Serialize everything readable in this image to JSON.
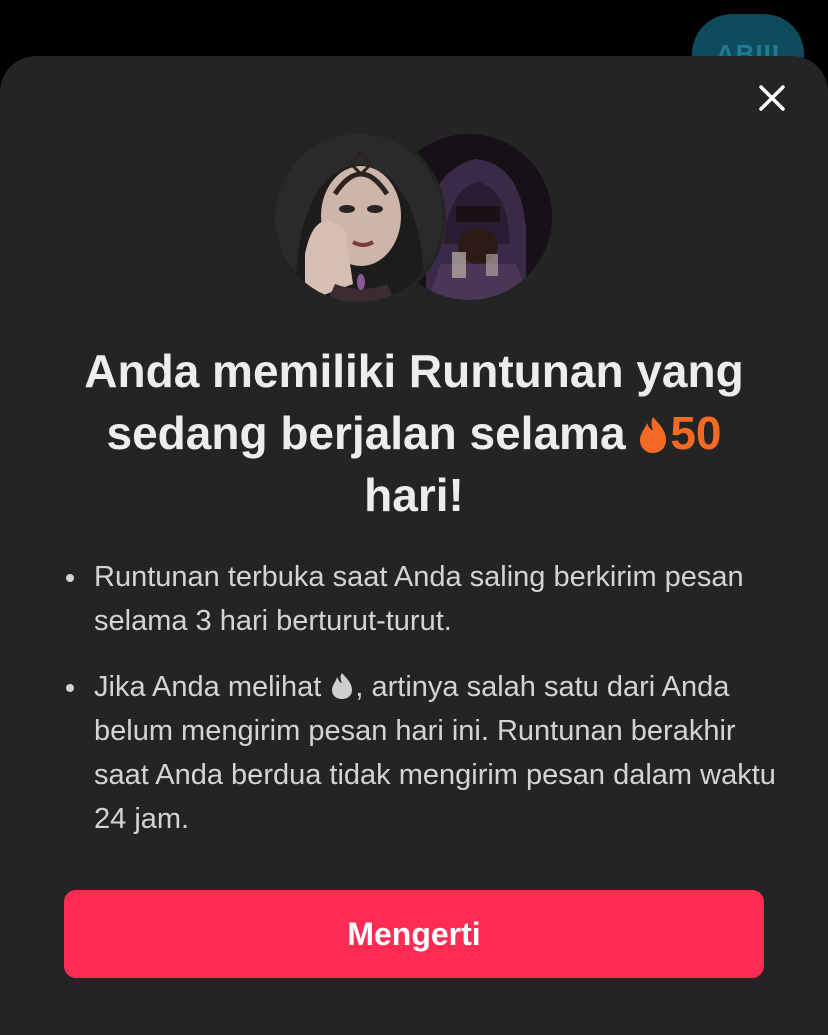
{
  "backdrop": {
    "pill_text": "ABIII"
  },
  "dialog": {
    "headline_text": "Anda memiliki Runtunan yang sedang berjalan selama",
    "streak_count": "50",
    "headline_suffix": "hari!",
    "bullets": [
      {
        "text": "Runtunan terbuka saat Anda saling berkirim pesan selama 3 hari berturut-turut."
      },
      {
        "before_icon": "Jika Anda melihat",
        "icon": "grey-flame-icon",
        "after_icon": ", artinya salah satu dari Anda belum mengirim pesan hari ini. Runtunan berakhir saat Anda berdua tidak mengirim pesan dalam waktu 24 jam."
      }
    ],
    "button_label": "Mengerti"
  },
  "colors": {
    "sheet_bg": "#242424",
    "accent": "#fe2c55",
    "streak": "#f26a24"
  }
}
